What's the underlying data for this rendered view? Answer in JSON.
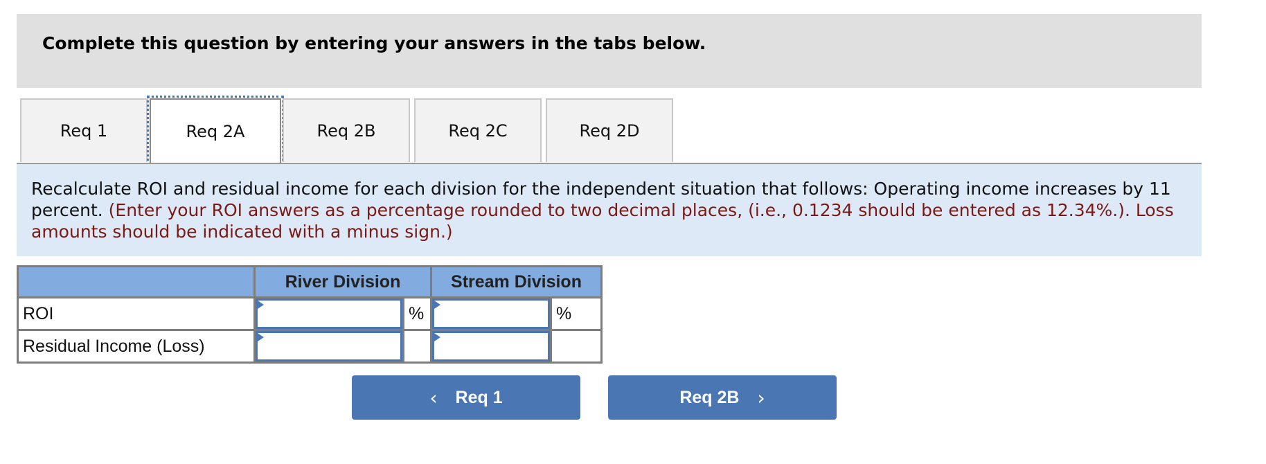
{
  "header": {
    "instruction": "Complete this question by entering your answers in the tabs below."
  },
  "tabs": [
    {
      "label": "Req 1",
      "active": false
    },
    {
      "label": "Req 2A",
      "active": true
    },
    {
      "label": "Req 2B",
      "active": false
    },
    {
      "label": "Req 2C",
      "active": false
    },
    {
      "label": "Req 2D",
      "active": false
    }
  ],
  "question": {
    "text": "Recalculate ROI and residual income for each division for the independent situation that follows: Operating income increases by 11 percent.",
    "note": "(Enter your ROI answers as a percentage rounded to two decimal places, (i.e., 0.1234 should be entered as 12.34%.). Loss amounts should be indicated with a minus sign.)"
  },
  "table": {
    "columns": [
      "",
      "River Division",
      "Stream Division"
    ],
    "rows": [
      {
        "label": "ROI",
        "river_value": "",
        "river_unit": "%",
        "stream_value": "",
        "stream_unit": "%"
      },
      {
        "label": "Residual Income (Loss)",
        "river_value": "",
        "river_unit": "",
        "stream_value": "",
        "stream_unit": ""
      }
    ]
  },
  "navigation": {
    "prev_label": "Req 1",
    "next_label": "Req 2B",
    "prev_icon": "chevron-left-icon",
    "next_icon": "chevron-right-icon",
    "button_color": "#4a77b4"
  }
}
